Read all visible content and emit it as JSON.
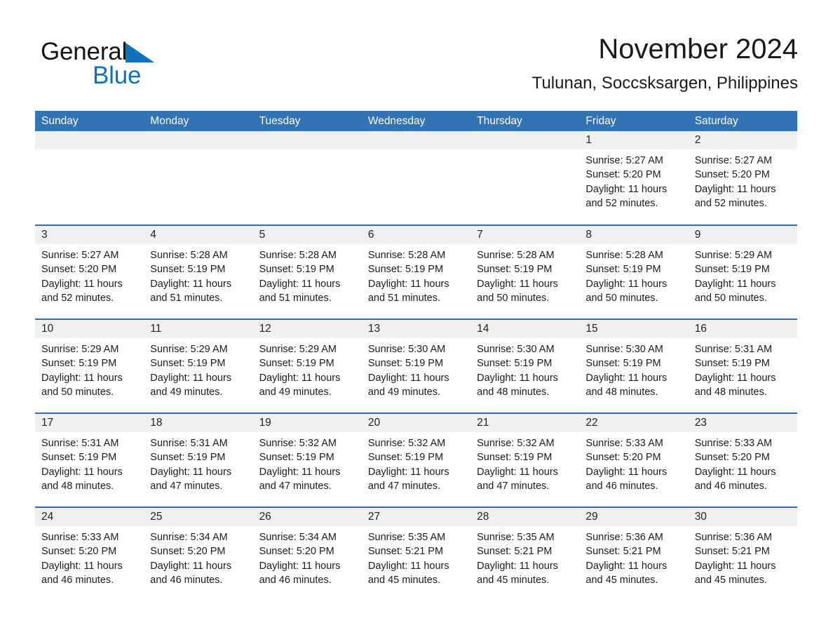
{
  "brand": {
    "name_part1": "General",
    "name_part2": "Blue",
    "logo_icon": "blue-triangle-logo",
    "accent_color": "#1072bb"
  },
  "header": {
    "title": "November 2024",
    "subtitle": "Tulunan, Soccsksargen, Philippines"
  },
  "colors": {
    "header_blue": "#3173b4",
    "row_divider_blue": "#2f6fb0",
    "daynum_band": "#f0f0f0",
    "text": "#1c1c1c"
  },
  "weekday_headers": [
    "Sunday",
    "Monday",
    "Tuesday",
    "Wednesday",
    "Thursday",
    "Friday",
    "Saturday"
  ],
  "weeks": [
    [
      {
        "day": "",
        "sunrise": "",
        "sunset": "",
        "daylight": "",
        "empty": true
      },
      {
        "day": "",
        "sunrise": "",
        "sunset": "",
        "daylight": "",
        "empty": true
      },
      {
        "day": "",
        "sunrise": "",
        "sunset": "",
        "daylight": "",
        "empty": true
      },
      {
        "day": "",
        "sunrise": "",
        "sunset": "",
        "daylight": "",
        "empty": true
      },
      {
        "day": "",
        "sunrise": "",
        "sunset": "",
        "daylight": "",
        "empty": true
      },
      {
        "day": "1",
        "sunrise": "Sunrise: 5:27 AM",
        "sunset": "Sunset: 5:20 PM",
        "daylight": "Daylight: 11 hours and 52 minutes.",
        "empty": false
      },
      {
        "day": "2",
        "sunrise": "Sunrise: 5:27 AM",
        "sunset": "Sunset: 5:20 PM",
        "daylight": "Daylight: 11 hours and 52 minutes.",
        "empty": false
      }
    ],
    [
      {
        "day": "3",
        "sunrise": "Sunrise: 5:27 AM",
        "sunset": "Sunset: 5:20 PM",
        "daylight": "Daylight: 11 hours and 52 minutes.",
        "empty": false
      },
      {
        "day": "4",
        "sunrise": "Sunrise: 5:28 AM",
        "sunset": "Sunset: 5:19 PM",
        "daylight": "Daylight: 11 hours and 51 minutes.",
        "empty": false
      },
      {
        "day": "5",
        "sunrise": "Sunrise: 5:28 AM",
        "sunset": "Sunset: 5:19 PM",
        "daylight": "Daylight: 11 hours and 51 minutes.",
        "empty": false
      },
      {
        "day": "6",
        "sunrise": "Sunrise: 5:28 AM",
        "sunset": "Sunset: 5:19 PM",
        "daylight": "Daylight: 11 hours and 51 minutes.",
        "empty": false
      },
      {
        "day": "7",
        "sunrise": "Sunrise: 5:28 AM",
        "sunset": "Sunset: 5:19 PM",
        "daylight": "Daylight: 11 hours and 50 minutes.",
        "empty": false
      },
      {
        "day": "8",
        "sunrise": "Sunrise: 5:28 AM",
        "sunset": "Sunset: 5:19 PM",
        "daylight": "Daylight: 11 hours and 50 minutes.",
        "empty": false
      },
      {
        "day": "9",
        "sunrise": "Sunrise: 5:29 AM",
        "sunset": "Sunset: 5:19 PM",
        "daylight": "Daylight: 11 hours and 50 minutes.",
        "empty": false
      }
    ],
    [
      {
        "day": "10",
        "sunrise": "Sunrise: 5:29 AM",
        "sunset": "Sunset: 5:19 PM",
        "daylight": "Daylight: 11 hours and 50 minutes.",
        "empty": false
      },
      {
        "day": "11",
        "sunrise": "Sunrise: 5:29 AM",
        "sunset": "Sunset: 5:19 PM",
        "daylight": "Daylight: 11 hours and 49 minutes.",
        "empty": false
      },
      {
        "day": "12",
        "sunrise": "Sunrise: 5:29 AM",
        "sunset": "Sunset: 5:19 PM",
        "daylight": "Daylight: 11 hours and 49 minutes.",
        "empty": false
      },
      {
        "day": "13",
        "sunrise": "Sunrise: 5:30 AM",
        "sunset": "Sunset: 5:19 PM",
        "daylight": "Daylight: 11 hours and 49 minutes.",
        "empty": false
      },
      {
        "day": "14",
        "sunrise": "Sunrise: 5:30 AM",
        "sunset": "Sunset: 5:19 PM",
        "daylight": "Daylight: 11 hours and 48 minutes.",
        "empty": false
      },
      {
        "day": "15",
        "sunrise": "Sunrise: 5:30 AM",
        "sunset": "Sunset: 5:19 PM",
        "daylight": "Daylight: 11 hours and 48 minutes.",
        "empty": false
      },
      {
        "day": "16",
        "sunrise": "Sunrise: 5:31 AM",
        "sunset": "Sunset: 5:19 PM",
        "daylight": "Daylight: 11 hours and 48 minutes.",
        "empty": false
      }
    ],
    [
      {
        "day": "17",
        "sunrise": "Sunrise: 5:31 AM",
        "sunset": "Sunset: 5:19 PM",
        "daylight": "Daylight: 11 hours and 48 minutes.",
        "empty": false
      },
      {
        "day": "18",
        "sunrise": "Sunrise: 5:31 AM",
        "sunset": "Sunset: 5:19 PM",
        "daylight": "Daylight: 11 hours and 47 minutes.",
        "empty": false
      },
      {
        "day": "19",
        "sunrise": "Sunrise: 5:32 AM",
        "sunset": "Sunset: 5:19 PM",
        "daylight": "Daylight: 11 hours and 47 minutes.",
        "empty": false
      },
      {
        "day": "20",
        "sunrise": "Sunrise: 5:32 AM",
        "sunset": "Sunset: 5:19 PM",
        "daylight": "Daylight: 11 hours and 47 minutes.",
        "empty": false
      },
      {
        "day": "21",
        "sunrise": "Sunrise: 5:32 AM",
        "sunset": "Sunset: 5:19 PM",
        "daylight": "Daylight: 11 hours and 47 minutes.",
        "empty": false
      },
      {
        "day": "22",
        "sunrise": "Sunrise: 5:33 AM",
        "sunset": "Sunset: 5:20 PM",
        "daylight": "Daylight: 11 hours and 46 minutes.",
        "empty": false
      },
      {
        "day": "23",
        "sunrise": "Sunrise: 5:33 AM",
        "sunset": "Sunset: 5:20 PM",
        "daylight": "Daylight: 11 hours and 46 minutes.",
        "empty": false
      }
    ],
    [
      {
        "day": "24",
        "sunrise": "Sunrise: 5:33 AM",
        "sunset": "Sunset: 5:20 PM",
        "daylight": "Daylight: 11 hours and 46 minutes.",
        "empty": false
      },
      {
        "day": "25",
        "sunrise": "Sunrise: 5:34 AM",
        "sunset": "Sunset: 5:20 PM",
        "daylight": "Daylight: 11 hours and 46 minutes.",
        "empty": false
      },
      {
        "day": "26",
        "sunrise": "Sunrise: 5:34 AM",
        "sunset": "Sunset: 5:20 PM",
        "daylight": "Daylight: 11 hours and 46 minutes.",
        "empty": false
      },
      {
        "day": "27",
        "sunrise": "Sunrise: 5:35 AM",
        "sunset": "Sunset: 5:21 PM",
        "daylight": "Daylight: 11 hours and 45 minutes.",
        "empty": false
      },
      {
        "day": "28",
        "sunrise": "Sunrise: 5:35 AM",
        "sunset": "Sunset: 5:21 PM",
        "daylight": "Daylight: 11 hours and 45 minutes.",
        "empty": false
      },
      {
        "day": "29",
        "sunrise": "Sunrise: 5:36 AM",
        "sunset": "Sunset: 5:21 PM",
        "daylight": "Daylight: 11 hours and 45 minutes.",
        "empty": false
      },
      {
        "day": "30",
        "sunrise": "Sunrise: 5:36 AM",
        "sunset": "Sunset: 5:21 PM",
        "daylight": "Daylight: 11 hours and 45 minutes.",
        "empty": false
      }
    ]
  ]
}
